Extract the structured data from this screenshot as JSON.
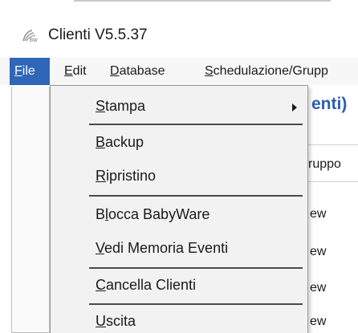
{
  "window": {
    "title": "Clienti V5.5.37"
  },
  "menubar": {
    "file": {
      "first": "F",
      "rest": "ile"
    },
    "edit": {
      "first": "E",
      "rest": "dit"
    },
    "database": {
      "first": "D",
      "rest": "atabase"
    },
    "schedulazione": {
      "first": "S",
      "rest": "chedulazione/Grupp"
    }
  },
  "file_menu": {
    "stampa": {
      "first": "S",
      "rest": "tampa"
    },
    "backup": {
      "first": "B",
      "rest": "ackup"
    },
    "ripristino": {
      "first": "R",
      "rest": "ipristino"
    },
    "blocca": {
      "pre": "B",
      "first": "l",
      "rest": "occa BabyWare"
    },
    "vedi": {
      "first": "V",
      "rest": "edi Memoria Eventi"
    },
    "cancella": {
      "first": "C",
      "rest": "ancella Clienti"
    },
    "uscita": {
      "first": "U",
      "rest": "scita"
    }
  },
  "background": {
    "header": "enti)",
    "column_header": "ruppo",
    "rows": [
      "ew",
      "ew",
      "ew",
      "ew"
    ]
  },
  "icons": {
    "app": "app-logo-icon",
    "submenu": "submenu-arrow-icon"
  },
  "colors": {
    "menu_active_bg": "#2f66b8",
    "header_text": "#2a5fb0"
  }
}
